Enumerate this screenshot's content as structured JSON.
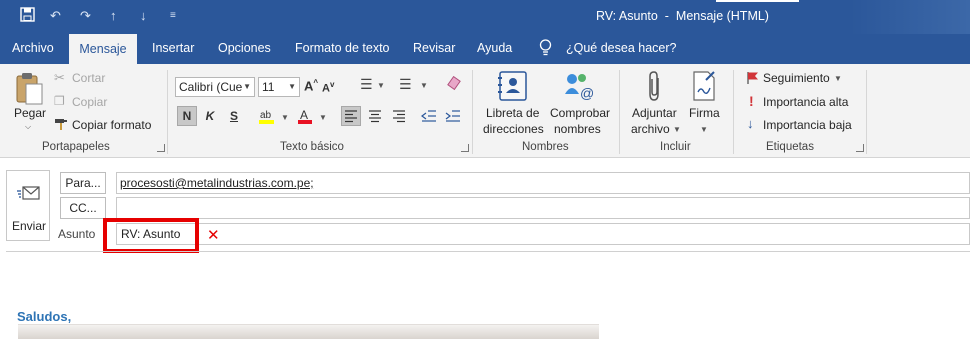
{
  "window": {
    "title": "RV: Asunto  -  Mensaje (HTML)"
  },
  "quick_access": {
    "icons": [
      "save-icon",
      "undo-icon",
      "redo-icon",
      "up-arrow-icon",
      "down-arrow-icon",
      "customize-icon"
    ]
  },
  "tabs": [
    {
      "label": "Archivo"
    },
    {
      "label": "Mensaje",
      "active": true
    },
    {
      "label": "Insertar"
    },
    {
      "label": "Opciones"
    },
    {
      "label": "Formato de texto"
    },
    {
      "label": "Revisar"
    },
    {
      "label": "Ayuda"
    }
  ],
  "tell_me": {
    "placeholder": "¿Qué desea hacer?"
  },
  "ribbon": {
    "clipboard": {
      "group_label": "Portapapeles",
      "paste": "Pegar",
      "cut": "Cortar",
      "copy": "Copiar",
      "format_painter": "Copiar formato"
    },
    "basic_text": {
      "group_label": "Texto básico",
      "font": "Calibri (Cue",
      "size": "11",
      "bold": "N",
      "italic": "K",
      "underline": "S"
    },
    "names": {
      "group_label": "Nombres",
      "address_book_line1": "Libreta de",
      "address_book_line2": "direcciones",
      "check_names_line1": "Comprobar",
      "check_names_line2": "nombres"
    },
    "include": {
      "group_label": "Incluir",
      "attach_line1": "Adjuntar",
      "attach_line2": "archivo",
      "signature": "Firma"
    },
    "tags": {
      "group_label": "Etiquetas",
      "follow_up": "Seguimiento",
      "high_importance": "Importancia alta",
      "low_importance": "Importancia baja"
    }
  },
  "compose": {
    "send": "Enviar",
    "to_button": "Para...",
    "to_value": "procesosti@metalindustrias.com.pe;",
    "cc_button": "CC...",
    "cc_value": "",
    "subject_label": "Asunto",
    "subject_value": "RV: Asunto"
  },
  "body": {
    "greeting": "Saludos,"
  },
  "colors": {
    "accent": "#2b579a",
    "highlight": "#e60000",
    "greeting": "#2e74b5"
  }
}
